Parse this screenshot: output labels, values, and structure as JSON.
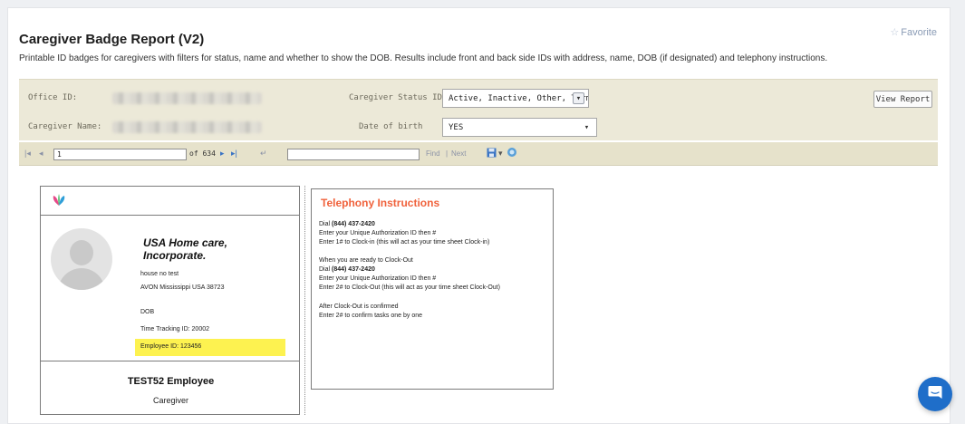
{
  "header": {
    "title": "Caregiver Badge Report (V2)",
    "favorite_label": "Favorite",
    "description": "Printable ID badges for caregivers with filters for status, name and whether to show the DOB. Results include front and back side IDs with address, name, DOB (if designated) and telephony instructions."
  },
  "filters": {
    "office_id_label": "Office ID:",
    "caregiver_status_label": "Caregiver Status ID:",
    "caregiver_status_value": "Active, Inactive, Other, Terminate",
    "caregiver_name_label": "Caregiver Name:",
    "dob_label": "Date of birth",
    "dob_value": "YES",
    "view_report_label": "View Report"
  },
  "toolbar": {
    "page_value": "1",
    "of_pages": "of 634",
    "find_label": "Find",
    "separator": "|",
    "next_label": "Next"
  },
  "badge_front": {
    "company_line1": "USA Home care,",
    "company_line2": "Incorporate.",
    "address_line1": "house no test",
    "address_line2": "AVON Mississippi USA 38723",
    "dob_label": "DOB",
    "time_tracking": "Time Tracking ID: 20002",
    "employee_id": "Employee ID: 123456",
    "employee_name": "TEST52 Employee",
    "role": "Caregiver"
  },
  "badge_back": {
    "title": "Telephony Instructions",
    "dial_prefix": "Dial",
    "phone": "(844) 437-2420",
    "line_unique_id_1": "Enter your Unique Authorization ID then #",
    "line_clock_in": "Enter 1# to Clock-in (this will act as your time sheet Clock-in)",
    "line_ready_clock_out": "When you are ready to Clock-Out",
    "line_unique_id_2": "Enter your Unique Authorization ID then #",
    "line_clock_out": "Enter 2# to Clock-Out (this will act as your time sheet Clock-Out)",
    "line_after_clock_out": "After Clock-Out is confirmed",
    "line_confirm_tasks": "Enter 2# to confirm tasks one by one"
  },
  "colors": {
    "filter_bg": "#ece9d8",
    "telephony_title": "#f0623c",
    "highlight": "#fdf250",
    "chat_button": "#1f6ec9"
  },
  "icons": [
    "star-icon",
    "first-page-icon",
    "prev-page-icon",
    "next-page-icon",
    "last-page-icon",
    "back-icon",
    "save-icon",
    "refresh-icon",
    "logo-icon",
    "avatar-placeholder-icon",
    "chat-icon"
  ]
}
